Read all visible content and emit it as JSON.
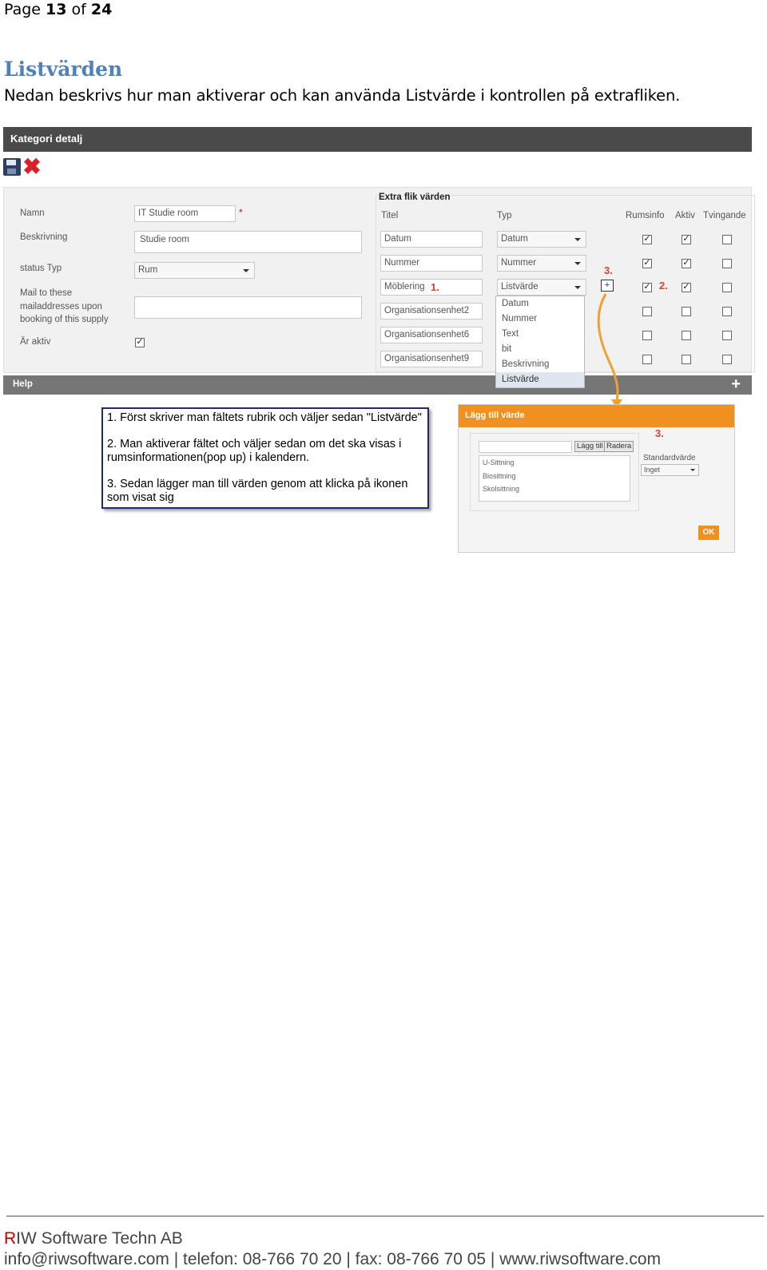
{
  "document": {
    "page_label_prefix": "Page",
    "page_current": "13",
    "page_of": "of",
    "page_total": "24",
    "section_title": "Listvärden",
    "intro": "Nedan beskrivs hur man aktiverar och kan använda Listvärde i kontrollen på extrafliken."
  },
  "panel": {
    "header": "Kategori detalj",
    "toolbar": {
      "save_icon": "save-icon",
      "close_icon": "close-icon",
      "close_glyph": "✖"
    }
  },
  "form": {
    "namn_label": "Namn",
    "namn_value": "IT Studie room",
    "required_mark": "*",
    "beskrivning_label": "Beskrivning",
    "beskrivning_value": "Studie room",
    "status_label": "status Typ",
    "status_value": "Rum",
    "mail_label_1": "Mail to these",
    "mail_label_2": "mailaddresses upon",
    "mail_label_3": "booking of this supply",
    "aktiv_label": "Är aktiv",
    "aktiv_checked": "✓"
  },
  "extra": {
    "title": "Extra flik värden",
    "col_titel": "Titel",
    "col_typ": "Typ",
    "col_rumsinfo": "Rumsinfo",
    "col_aktiv": "Aktiv",
    "col_tvingande": "Tvingande",
    "rows": [
      {
        "titel": "Datum",
        "typ": "Datum"
      },
      {
        "titel": "Nummer",
        "typ": "Nummer"
      },
      {
        "titel": "Möblering",
        "typ": "Listvärde"
      },
      {
        "titel": "Organisationsenhet2"
      },
      {
        "titel": "Organisationsenhet6"
      },
      {
        "titel": "Organisationsenhet9"
      }
    ],
    "marker_1": "1.",
    "marker_2": "2.",
    "marker_3": "3.",
    "check": "✓",
    "dropdown_options": [
      "Datum",
      "Nummer",
      "Text",
      "bit",
      "Beskrivning",
      "Listvärde"
    ],
    "add_icon_glyph": "+"
  },
  "help": {
    "label": "Help",
    "plus": "+"
  },
  "instructions": {
    "line1": "1. Först skriver man fältets rubrik och väljer sedan \"Listvärde\"",
    "line2": "2. Man aktiverar fältet och väljer sedan om det ska visas i rumsinformationen(pop up) i kalendern.",
    "line3": "3. Sedan lägger man till värden genom att klicka på ikonen som visat sig"
  },
  "dialog": {
    "title": "Lägg till värde",
    "add_button": "Lägg till",
    "delete_button": "Radera",
    "marker": "3.",
    "items": [
      "U-Sittning",
      "Biosittning",
      "Skolsittning"
    ],
    "std_label": "Standardvärde",
    "std_value": "Inget",
    "ok": "OK"
  },
  "footer": {
    "company_r": "R",
    "company_rest": "IW Software Techn AB",
    "contact": "info@riwsoftware.com | telefon: 08-766 70 20 | fax: 08-766 70 05 | www.riwsoftware.com"
  },
  "colors": {
    "title_blue": "#4f81bd",
    "dialog_orange": "#f0901f",
    "marker_red": "#e04030",
    "header_dark": "#4a4a4a"
  }
}
